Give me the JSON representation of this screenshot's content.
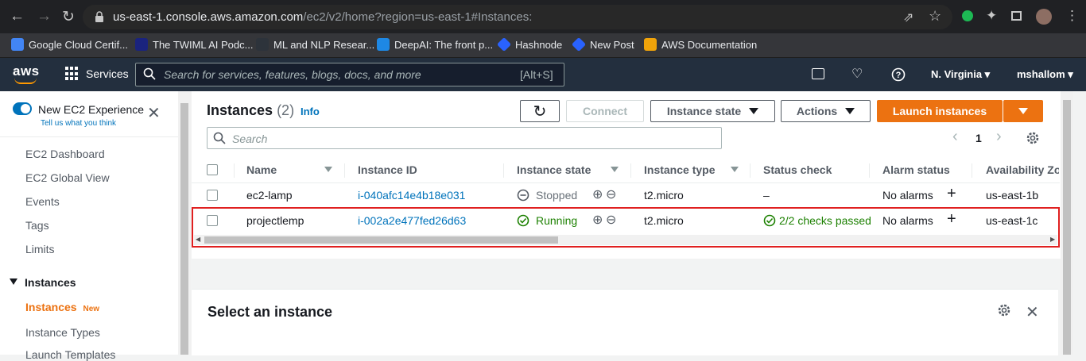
{
  "browser": {
    "url_host": "us-east-1.console.aws.amazon.com",
    "url_path": "/ec2/v2/home?region=us-east-1#Instances:",
    "bookmarks": [
      {
        "label": "Google Cloud Certif...",
        "icon": "google-cloud-icon",
        "color": "#4285f4"
      },
      {
        "label": "The TWIML AI Podc...",
        "icon": "twiml-icon",
        "color": "#1a237e"
      },
      {
        "label": "ML and NLP Resear...",
        "icon": "ml-nlp-icon",
        "color": "#2d333b"
      },
      {
        "label": "DeepAI: The front p...",
        "icon": "deepai-icon",
        "color": "#1e88e5"
      },
      {
        "label": "Hashnode",
        "icon": "hashnode-icon",
        "color": "#2962ff"
      },
      {
        "label": "New Post",
        "icon": "hashnode-icon",
        "color": "#2962ff"
      },
      {
        "label": "AWS Documentation",
        "icon": "aws-doc-icon",
        "color": "#f0a30a"
      }
    ]
  },
  "aws_nav": {
    "logo": "aws",
    "services": "Services",
    "search_placeholder": "Search for services, features, blogs, docs, and more",
    "search_shortcut": "[Alt+S]",
    "region": "N. Virginia",
    "user": "mshallom"
  },
  "sidebar": {
    "new_experience": "New EC2 Experience",
    "tell_us": "Tell us what you think",
    "items": [
      "EC2 Dashboard",
      "EC2 Global View",
      "Events",
      "Tags",
      "Limits"
    ],
    "section": "Instances",
    "active": "Instances",
    "new_badge": "New",
    "instance_types": "Instance Types",
    "launch_templates": "Launch Templates"
  },
  "main": {
    "title": "Instances",
    "count": "(2)",
    "info": "Info",
    "connect": "Connect",
    "instance_state": "Instance state",
    "actions": "Actions",
    "launch": "Launch instances",
    "search_placeholder": "Search",
    "page": "1",
    "columns": [
      "Name",
      "Instance ID",
      "Instance state",
      "Instance type",
      "Status check",
      "Alarm status",
      "Availability Zo"
    ],
    "rows": [
      {
        "name": "ec2-lamp",
        "id": "i-040afc14e4b18e031",
        "state": "Stopped",
        "type": "t2.micro",
        "status": "–",
        "alarm": "No alarms",
        "az": "us-east-1b"
      },
      {
        "name": "projectlemp",
        "id": "i-002a2e477fed26d63",
        "state": "Running",
        "type": "t2.micro",
        "status": "2/2 checks passed",
        "alarm": "No alarms",
        "az": "us-east-1c"
      }
    ],
    "select_instance": "Select an instance"
  }
}
